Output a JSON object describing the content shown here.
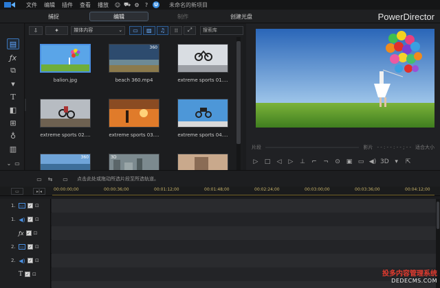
{
  "titlebar": {
    "menu": [
      "文件",
      "编辑",
      "插件",
      "查看",
      "播放"
    ],
    "project_title": "未命名的新项目"
  },
  "modes": {
    "capture": "捕捉",
    "edit": "编辑",
    "produce": "制作",
    "disc": "创建光盘"
  },
  "brand": "PowerDirector",
  "library": {
    "content_select": "媒体内容",
    "search_placeholder": "搜索库",
    "items": [
      {
        "name": "balion.jpg",
        "badge": "",
        "selected": true
      },
      {
        "name": "beach 360.mp4",
        "badge": "360",
        "selected": false
      },
      {
        "name": "extreme sports 01....",
        "badge": "",
        "selected": false
      },
      {
        "name": "extreme sports 02....",
        "badge": "",
        "selected": false
      },
      {
        "name": "extreme sports 03....",
        "badge": "",
        "selected": false
      },
      {
        "name": "extreme sports 04....",
        "badge": "",
        "selected": false
      },
      {
        "name": "",
        "badge": "360",
        "selected": false
      },
      {
        "name": "",
        "badge": "3D",
        "selected": false
      },
      {
        "name": "",
        "badge": "",
        "selected": false
      }
    ]
  },
  "preview": {
    "btn_clip": "片段",
    "btn_movie": "影片",
    "timecode": "- - : - - : - - ; - -",
    "zoom": "适合大小",
    "mode_3d": "3D"
  },
  "timeline": {
    "hint": "点击此处或拖动所选片段至所选轨道。",
    "ruler_ticks": [
      "00:00:00;00",
      "00:00:36;00",
      "00:01:12;00",
      "00:01:48;00",
      "00:02:24;00",
      "00:03:00;00",
      "00:03:36;00",
      "00:04:12;00"
    ],
    "tracks": [
      {
        "label": "1.",
        "kind": "video"
      },
      {
        "label": "1.",
        "kind": "audio"
      },
      {
        "label": "",
        "kind": "fx"
      },
      {
        "label": "2.",
        "kind": "video"
      },
      {
        "label": "2.",
        "kind": "audio"
      },
      {
        "label": "",
        "kind": "title"
      },
      {
        "label": "",
        "kind": "voice"
      }
    ]
  },
  "watermark": {
    "line1": "投多内容管理系统",
    "line2": "DEDECMS.COM"
  },
  "colors": {
    "accent": "#4a90e2",
    "ruler_text": "#c9b46a",
    "watermark": "#e33b2f"
  }
}
